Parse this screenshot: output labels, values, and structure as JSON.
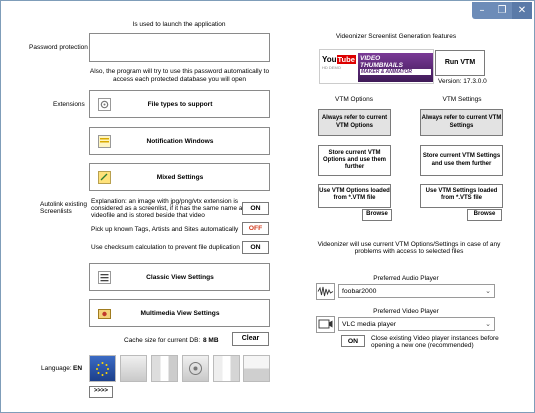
{
  "window": {
    "minimize_glyph": "–",
    "restore_glyph": "❐",
    "close_glyph": "✕"
  },
  "left": {
    "launch_caption": "Is used to launch the application",
    "password_label": "Password protection",
    "password_value": "",
    "password_note_1": "Also, the program will try to use this password automatically to",
    "password_note_2": "access each protected database you will open",
    "extensions_label": "Extensions",
    "btn_file_types": "File types to support",
    "btn_notification": "Notification Windows",
    "btn_mixed": "Mixed Settings",
    "autolink_label_1": "Autolink existing",
    "autolink_label_2": "Screenlists",
    "autolink_expl_1": "Explanation: an image with jpg/png/vtx extension is",
    "autolink_expl_2": "considered as a screenlist, if it has the same name as a",
    "autolink_expl_3": "videofile and is stored beside that video",
    "autolink_toggle": "ON",
    "pickup_text": "Pick up known Tags, Artists and Sites automatically",
    "pickup_toggle": "OFF",
    "checksum_text": "Use checksum calculation to prevent file duplication",
    "checksum_toggle": "ON",
    "btn_classic": "Classic View Settings",
    "btn_multimedia": "Multimedia View Settings",
    "cache_label": "Cache size for current DB:",
    "cache_value": "8 MB",
    "btn_clear": "Clear",
    "language_label": "Language:",
    "language_value": "EN",
    "btn_more": ">>>>"
  },
  "right": {
    "features_title": "Videonizer Screenlist Generation features",
    "logo_youtube_1": "You",
    "logo_youtube_2": "Tube",
    "logo_youtube_3": "HD DEMO",
    "logo_vtm_1": "VIDEO",
    "logo_vtm_2": "THUMBNAILS",
    "logo_vtm_3": "MAKER & ANIMATOR",
    "btn_run_vtm": "Run VTM",
    "version": "Version: 17.3.0.0",
    "col_options": "VTM Options",
    "col_settings": "VTM Settings",
    "btn_always_options": "Always refer to current VTM Options",
    "btn_always_settings": "Always refer to current VTM Settings",
    "btn_store_options": "Store current VTM Options and use them further",
    "btn_store_settings": "Store current VTM Settings and use them further",
    "btn_use_options_file": "Use VTM Options loaded from *.VTM file",
    "btn_use_settings_file": "Use VTM Settings loaded from *.VTS file",
    "btn_browse_1": "Browse",
    "btn_browse_2": "Browse",
    "note_1": "Videonizer will use current VTM Options/Settings in case of any",
    "note_2": "problems with access to selected files",
    "audio_label": "Preferred Audio Player",
    "audio_value": "foobar2000",
    "video_label": "Preferred Video Player",
    "video_value": "VLC media player",
    "close_toggle": "ON",
    "close_text_1": "Close existing Video player instances before",
    "close_text_2": "opening a new one (recommended)"
  }
}
